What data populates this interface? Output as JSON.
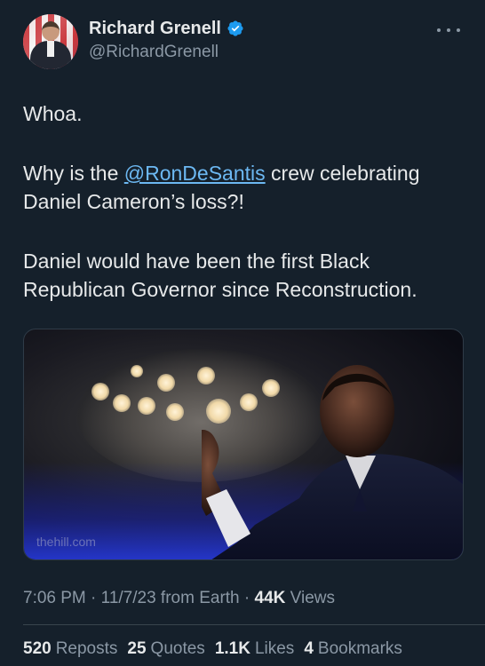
{
  "author": {
    "display_name": "Richard Grenell",
    "handle": "@RichardGrenell",
    "verified": true
  },
  "tweet": {
    "line1": "Whoa.",
    "line2_prefix": "Why is the ",
    "mention": "@RonDeSantis",
    "line2_suffix": " crew celebrating Daniel Cameron’s loss?!",
    "line3": "Daniel would have been the first Black Republican Governor since Reconstruction."
  },
  "media": {
    "watermark": "thehill.com"
  },
  "meta": {
    "time": "7:06 PM",
    "date": "11/7/23",
    "source": "from Earth",
    "views_count": "44K",
    "views_label": "Views"
  },
  "stats": {
    "reposts_count": "520",
    "reposts_label": "Reposts",
    "quotes_count": "25",
    "quotes_label": "Quotes",
    "likes_count": "1.1K",
    "likes_label": "Likes",
    "bookmarks_count": "4",
    "bookmarks_label": "Bookmarks"
  },
  "colors": {
    "background": "#15202b",
    "text": "#e7e9ea",
    "secondary": "#8b98a5",
    "link": "#6cb8f2",
    "verified": "#1d9bf0"
  }
}
